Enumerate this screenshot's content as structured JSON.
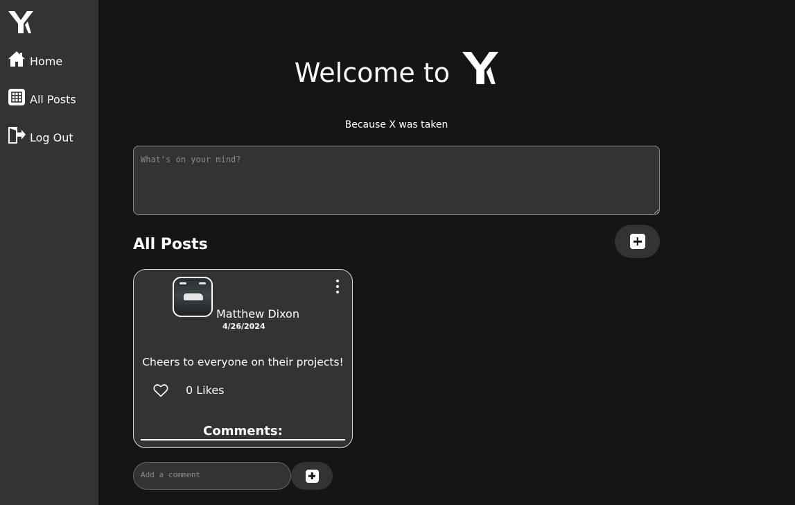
{
  "sidebar": {
    "logo_icon": "y-logo-icon",
    "items": [
      {
        "label": "Home",
        "icon": "house-icon"
      },
      {
        "label": "All Posts",
        "icon": "grid-icon"
      },
      {
        "label": "Log Out",
        "icon": "door-exit-icon"
      }
    ]
  },
  "header": {
    "welcome_text": "Welcome to",
    "tagline": "Because X was taken"
  },
  "composer": {
    "placeholder": "What's on your mind?"
  },
  "feed": {
    "heading": "All Posts",
    "add_post_icon": "plus-square-icon"
  },
  "post": {
    "author": "Matthew Dixon",
    "date": "4/26/2024",
    "text": "Cheers to everyone on their projects!",
    "likes_label": "0 Likes",
    "comments_heading": "Comments:"
  },
  "comment_box": {
    "placeholder": "Add a comment",
    "add_icon": "plus-square-icon"
  },
  "colors": {
    "background": "#161516",
    "panel": "#333333",
    "text": "#ffffff"
  }
}
